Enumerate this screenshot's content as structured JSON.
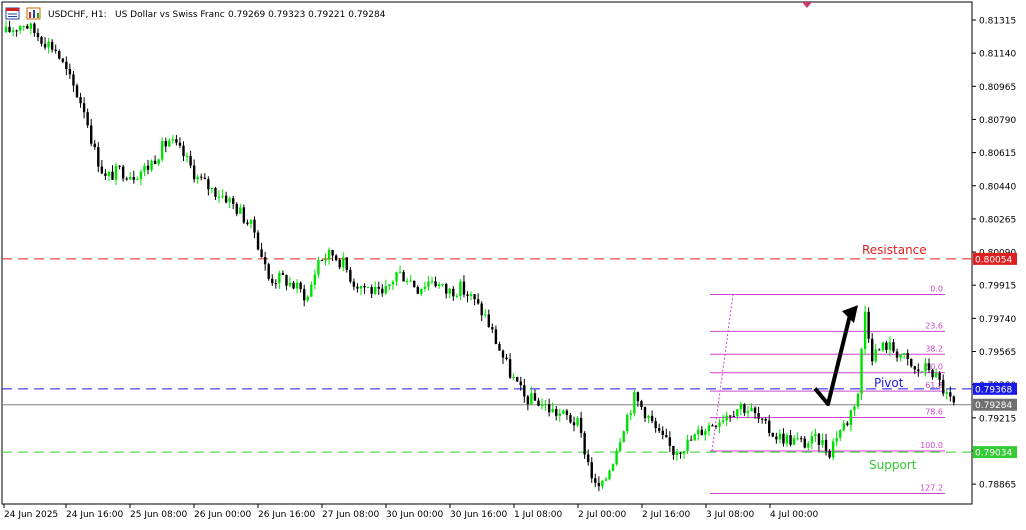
{
  "header": {
    "symbol": "USDCHF, H1:",
    "description": "US Dollar vs Swiss Franc",
    "ohlc": "0.79269 0.79323 0.79221 0.79284"
  },
  "colors": {
    "background": "#ffffff",
    "bull": "#00e000",
    "bear": "#000000",
    "resistance": "#e02020",
    "pivot": "#1a1ae8",
    "support": "#33cc33",
    "fib": "#cc44cc",
    "price_line": "#808080"
  },
  "icons": [
    "chart-window-icon",
    "chart-type-icon"
  ],
  "chart_data": {
    "type": "candlestick",
    "symbol": "USDCHF",
    "timeframe": "H1",
    "ylim": [
      0.7876,
      0.8141
    ],
    "y_ticks": [
      "0.81315",
      "0.81140",
      "0.80965",
      "0.80790",
      "0.80615",
      "0.80440",
      "0.80265",
      "0.80090",
      "0.79915",
      "0.79740",
      "0.79565",
      "0.79390",
      "0.79215",
      "0.79040",
      "0.78865"
    ],
    "x_ticks": [
      "24 Jun 2025",
      "24 Jun 16:00",
      "25 Jun 08:00",
      "26 Jun 00:00",
      "26 Jun 16:00",
      "27 Jun 08:00",
      "30 Jun 00:00",
      "30 Jun 16:00",
      "1 Jul 08:00",
      "2 Jul 00:00",
      "2 Jul 16:00",
      "3 Jul 08:00",
      "4 Jul 00:00"
    ],
    "close_path": [
      [
        0,
        0.8125
      ],
      [
        5,
        0.813
      ],
      [
        10,
        0.8122
      ],
      [
        14,
        0.8116
      ],
      [
        18,
        0.81
      ],
      [
        22,
        0.8085
      ],
      [
        25,
        0.8062
      ],
      [
        28,
        0.8048
      ],
      [
        32,
        0.8052
      ],
      [
        36,
        0.805
      ],
      [
        40,
        0.8054
      ],
      [
        44,
        0.8064
      ],
      [
        46,
        0.8068
      ],
      [
        50,
        0.806
      ],
      [
        54,
        0.8048
      ],
      [
        58,
        0.8042
      ],
      [
        62,
        0.8038
      ],
      [
        66,
        0.803
      ],
      [
        70,
        0.802
      ],
      [
        74,
        0.7995
      ],
      [
        78,
        0.7995
      ],
      [
        82,
        0.799
      ],
      [
        85,
        0.7985
      ],
      [
        88,
        0.8005
      ],
      [
        92,
        0.8008
      ],
      [
        95,
        0.8003
      ],
      [
        98,
        0.7993
      ],
      [
        102,
        0.799
      ],
      [
        106,
        0.7985
      ],
      [
        110,
        0.7998
      ],
      [
        113,
        0.7996
      ],
      [
        116,
        0.799
      ],
      [
        120,
        0.7995
      ],
      [
        124,
        0.7988
      ],
      [
        128,
        0.799
      ],
      [
        131,
        0.7985
      ],
      [
        135,
        0.7975
      ],
      [
        138,
        0.7962
      ],
      [
        142,
        0.7945
      ],
      [
        146,
        0.7932
      ],
      [
        150,
        0.793
      ],
      [
        154,
        0.7925
      ],
      [
        158,
        0.7922
      ],
      [
        161,
        0.7918
      ],
      [
        164,
        0.7898
      ],
      [
        166,
        0.7885
      ],
      [
        168,
        0.7885
      ],
      [
        171,
        0.79
      ],
      [
        174,
        0.7918
      ],
      [
        177,
        0.7932
      ],
      [
        180,
        0.7925
      ],
      [
        184,
        0.7912
      ],
      [
        188,
        0.7904
      ],
      [
        192,
        0.7908
      ],
      [
        196,
        0.7915
      ],
      [
        200,
        0.792
      ],
      [
        204,
        0.7925
      ],
      [
        207,
        0.7928
      ],
      [
        210,
        0.7925
      ],
      [
        213,
        0.7918
      ],
      [
        217,
        0.7912
      ],
      [
        221,
        0.791
      ],
      [
        225,
        0.7908
      ],
      [
        229,
        0.791
      ],
      [
        232,
        0.7904
      ],
      [
        234,
        0.7913
      ],
      [
        237,
        0.792
      ],
      [
        240,
        0.7935
      ],
      [
        242,
        0.7978
      ],
      [
        244,
        0.7955
      ],
      [
        248,
        0.796
      ],
      [
        252,
        0.7955
      ],
      [
        256,
        0.7946
      ],
      [
        260,
        0.7948
      ],
      [
        263,
        0.794
      ],
      [
        265,
        0.7933
      ],
      [
        267,
        0.7928
      ]
    ],
    "horizontal_levels": [
      {
        "label": "Resistance",
        "value": 0.80054,
        "price_tag": "0.80054",
        "style": "dashed",
        "color": "#e02020"
      },
      {
        "label": "Pivot",
        "value": 0.79368,
        "price_tag": "0.79368",
        "style": "dashed",
        "color": "#1a1ae8"
      },
      {
        "label": "Support",
        "value": 0.79034,
        "price_tag": "0.79034",
        "style": "dashed",
        "color": "#33cc33"
      }
    ],
    "current_price": {
      "value": 0.79284,
      "tag": "0.79284"
    },
    "fibonacci": {
      "high": 0.79866,
      "low": 0.7904,
      "levels": [
        {
          "label": "0.0",
          "ratio": 0.0
        },
        {
          "label": "23.6",
          "ratio": 0.236
        },
        {
          "label": "38.2",
          "ratio": 0.382
        },
        {
          "label": "50.0",
          "ratio": 0.5
        },
        {
          "label": "61.8",
          "ratio": 0.618
        },
        {
          "label": "78.6",
          "ratio": 0.786
        },
        {
          "label": "100.0",
          "ratio": 1.0
        },
        {
          "label": "127.2",
          "ratio": 1.272
        }
      ]
    },
    "annotations": [
      "Resistance",
      "Pivot",
      "Support"
    ],
    "projection_arrow": {
      "direction": "up",
      "from": 0.7937,
      "dip_to": 0.7934,
      "to": 0.7981
    }
  }
}
